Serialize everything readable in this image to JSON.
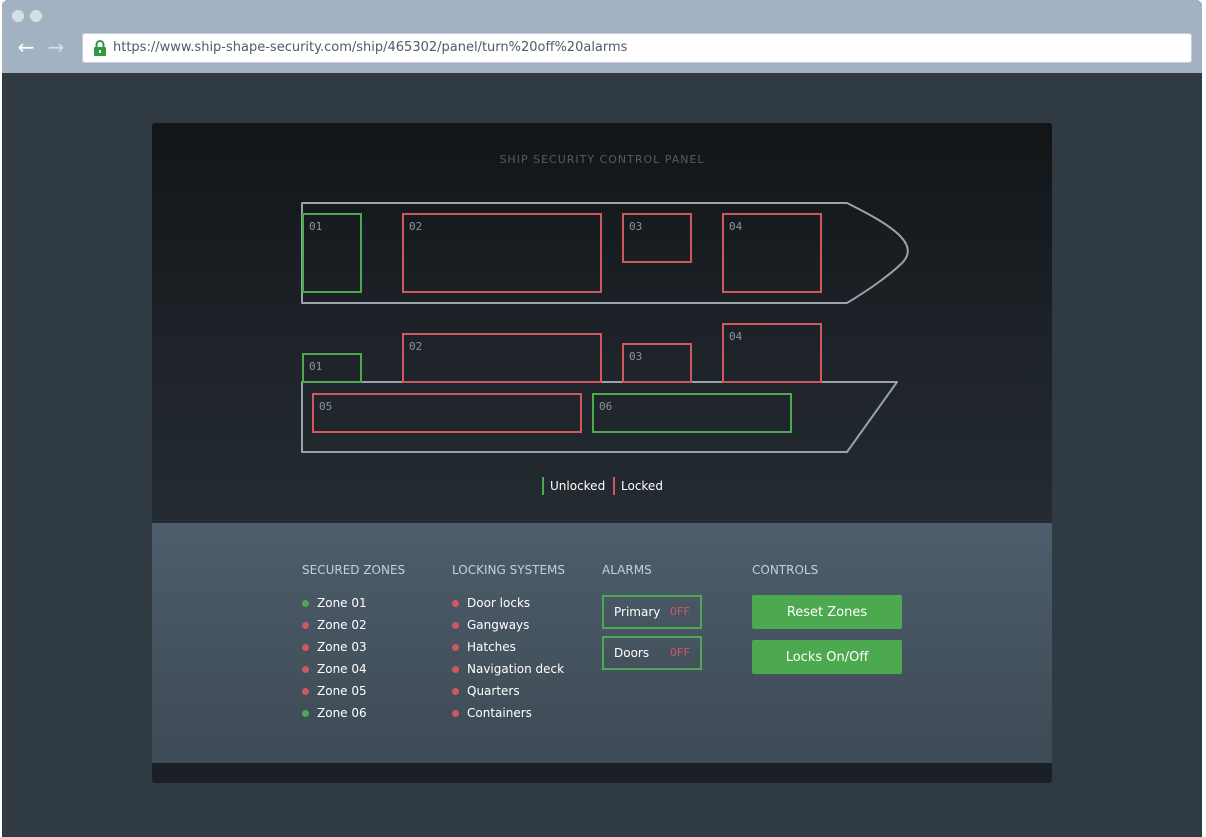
{
  "browser": {
    "url": "https://www.ship-shape-security.com/ship/465302/panel/turn%20off%20alarms",
    "back_icon": "←",
    "forward_icon": "→"
  },
  "panel": {
    "title": "SHIP SECURITY CONTROL PANEL"
  },
  "ship": {
    "top_view": {
      "zones": [
        {
          "label": "01",
          "status": "unlocked"
        },
        {
          "label": "02",
          "status": "locked"
        },
        {
          "label": "03",
          "status": "locked"
        },
        {
          "label": "04",
          "status": "locked"
        }
      ]
    },
    "side_view": {
      "zones": [
        {
          "label": "01",
          "status": "unlocked"
        },
        {
          "label": "02",
          "status": "locked"
        },
        {
          "label": "03",
          "status": "locked"
        },
        {
          "label": "04",
          "status": "locked"
        },
        {
          "label": "05",
          "status": "locked"
        },
        {
          "label": "06",
          "status": "unlocked"
        }
      ]
    }
  },
  "legend": {
    "unlocked": "Unlocked",
    "locked": "Locked"
  },
  "colors": {
    "unlocked": "#4da94f",
    "locked": "#d0585c"
  },
  "secured_zones": {
    "title": "SECURED ZONES",
    "items": [
      {
        "label": "Zone 01",
        "status": "unlocked"
      },
      {
        "label": "Zone 02",
        "status": "locked"
      },
      {
        "label": "Zone 03",
        "status": "locked"
      },
      {
        "label": "Zone 04",
        "status": "locked"
      },
      {
        "label": "Zone 05",
        "status": "locked"
      },
      {
        "label": "Zone 06",
        "status": "unlocked"
      }
    ]
  },
  "locking_systems": {
    "title": "LOCKING SYSTEMS",
    "items": [
      {
        "label": "Door locks",
        "status": "locked"
      },
      {
        "label": "Gangways",
        "status": "locked"
      },
      {
        "label": "Hatches",
        "status": "locked"
      },
      {
        "label": "Navigation deck",
        "status": "locked"
      },
      {
        "label": "Quarters",
        "status": "locked"
      },
      {
        "label": "Containers",
        "status": "locked"
      }
    ]
  },
  "alarms": {
    "title": "ALARMS",
    "items": [
      {
        "name": "Primary",
        "state": "OFF"
      },
      {
        "name": "Doors",
        "state": "OFF"
      }
    ]
  },
  "controls": {
    "title": "CONTROLS",
    "reset_label": "Reset Zones",
    "locks_label": "Locks On/Off"
  }
}
